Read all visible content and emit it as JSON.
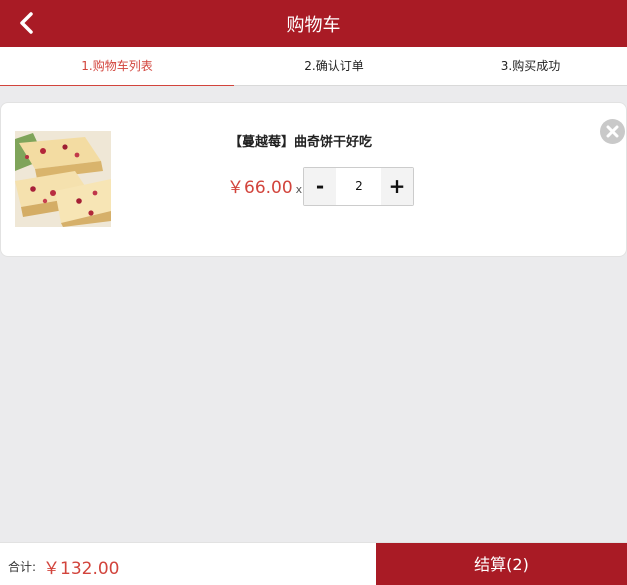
{
  "header": {
    "title": "购物车",
    "back_icon": "chevron-left-icon",
    "background_color": "#a91b25"
  },
  "steps": [
    {
      "label": "1.购物车列表",
      "active": true
    },
    {
      "label": "2.确认订单",
      "active": false
    },
    {
      "label": "3.购买成功",
      "active": false
    }
  ],
  "cart": {
    "items": [
      {
        "name": "【蔓越莓】曲奇饼干好吃",
        "price": "￥66.00",
        "times_symbol": "x",
        "quantity": "2",
        "minus_label": "-",
        "plus_label": "+",
        "image_icon": "cookie-product-image",
        "remove_icon": "close-circle-icon"
      }
    ]
  },
  "footer": {
    "total_label": "合计:",
    "total_value": "￥132.00",
    "checkout_label": "结算(2)"
  },
  "colors": {
    "accent": "#a91b25",
    "price": "#d2443c",
    "background": "#ebebed"
  }
}
